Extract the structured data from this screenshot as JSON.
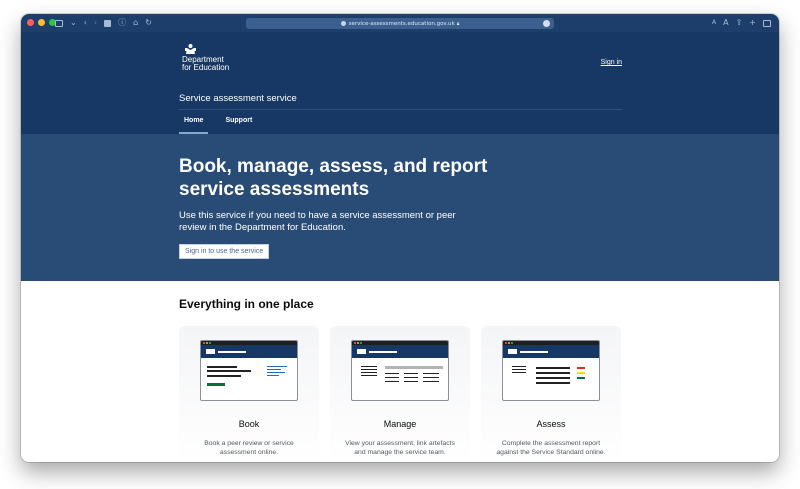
{
  "browser": {
    "url": "service-assessments.education.gov.uk",
    "traffic_lights": [
      "#ff5f57",
      "#febc2e",
      "#28c840"
    ],
    "text_size_small": "A",
    "text_size_large": "A"
  },
  "header": {
    "org_line1": "Department",
    "org_line2": "for Education",
    "service_name": "Service assessment service",
    "sign_in": "Sign in",
    "brand_color": "#173864"
  },
  "nav": {
    "items": [
      {
        "label": "Home",
        "active": true
      },
      {
        "label": "Support",
        "active": false
      }
    ]
  },
  "hero": {
    "title": "Book, manage, assess, and report service assessments",
    "description": "Use this service if you need to have a service assessment or peer review in the Department for Education.",
    "button": "Sign in to use the service",
    "background": "#294c76"
  },
  "features": {
    "heading": "Everything in one place",
    "cards": [
      {
        "title": "Book",
        "description": "Book a peer review or service assessment online."
      },
      {
        "title": "Manage",
        "description": "View your assessment, link artefacts and manage the service team."
      },
      {
        "title": "Assess",
        "description": "Complete the assessment report against the Service Standard online."
      }
    ]
  }
}
